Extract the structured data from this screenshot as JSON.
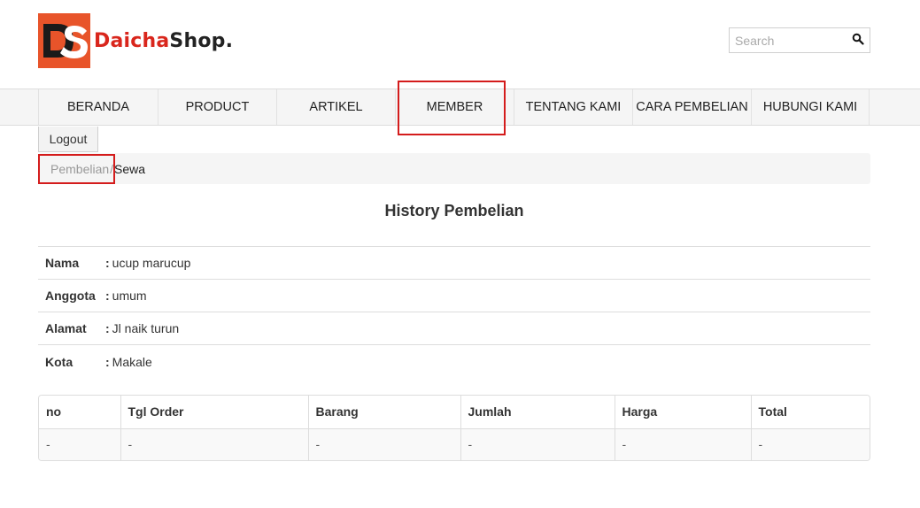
{
  "header": {
    "logo": {
      "mark_text": "DS",
      "brand_red": "Daicha",
      "brand_dark": "Shop."
    },
    "search": {
      "placeholder": "Search",
      "icon": "search-icon"
    }
  },
  "nav": {
    "items": [
      {
        "label": "BERANDA"
      },
      {
        "label": "PRODUCT"
      },
      {
        "label": "ARTIKEL"
      },
      {
        "label": "MEMBER"
      },
      {
        "label": "TENTANG KAMI"
      },
      {
        "label": "CARA PEMBELIAN"
      },
      {
        "label": "HUBUNGI KAMI"
      }
    ]
  },
  "logout_label": "Logout",
  "breadcrumb": {
    "link": "Pembelian",
    "separator": "/",
    "active": "Sewa"
  },
  "page_title": "History Pembelian",
  "info": {
    "rows": [
      {
        "label": "Nama",
        "colon": ":",
        "value": "ucup marucup"
      },
      {
        "label": "Anggota",
        "colon": ":",
        "value": "umum"
      },
      {
        "label": "Alamat",
        "colon": ":",
        "value": "Jl naik turun"
      },
      {
        "label": "Kota",
        "colon": ":",
        "value": "Makale"
      }
    ]
  },
  "history_table": {
    "headers": [
      "no",
      "Tgl Order",
      "Barang",
      "Jumlah",
      "Harga",
      "Total"
    ],
    "rows": [
      [
        "-",
        "-",
        "-",
        "-",
        "-",
        "-"
      ]
    ]
  },
  "colors": {
    "accent_red": "#d9261c",
    "logo_bg": "#e8542a",
    "highlight": "#d41c1c"
  }
}
